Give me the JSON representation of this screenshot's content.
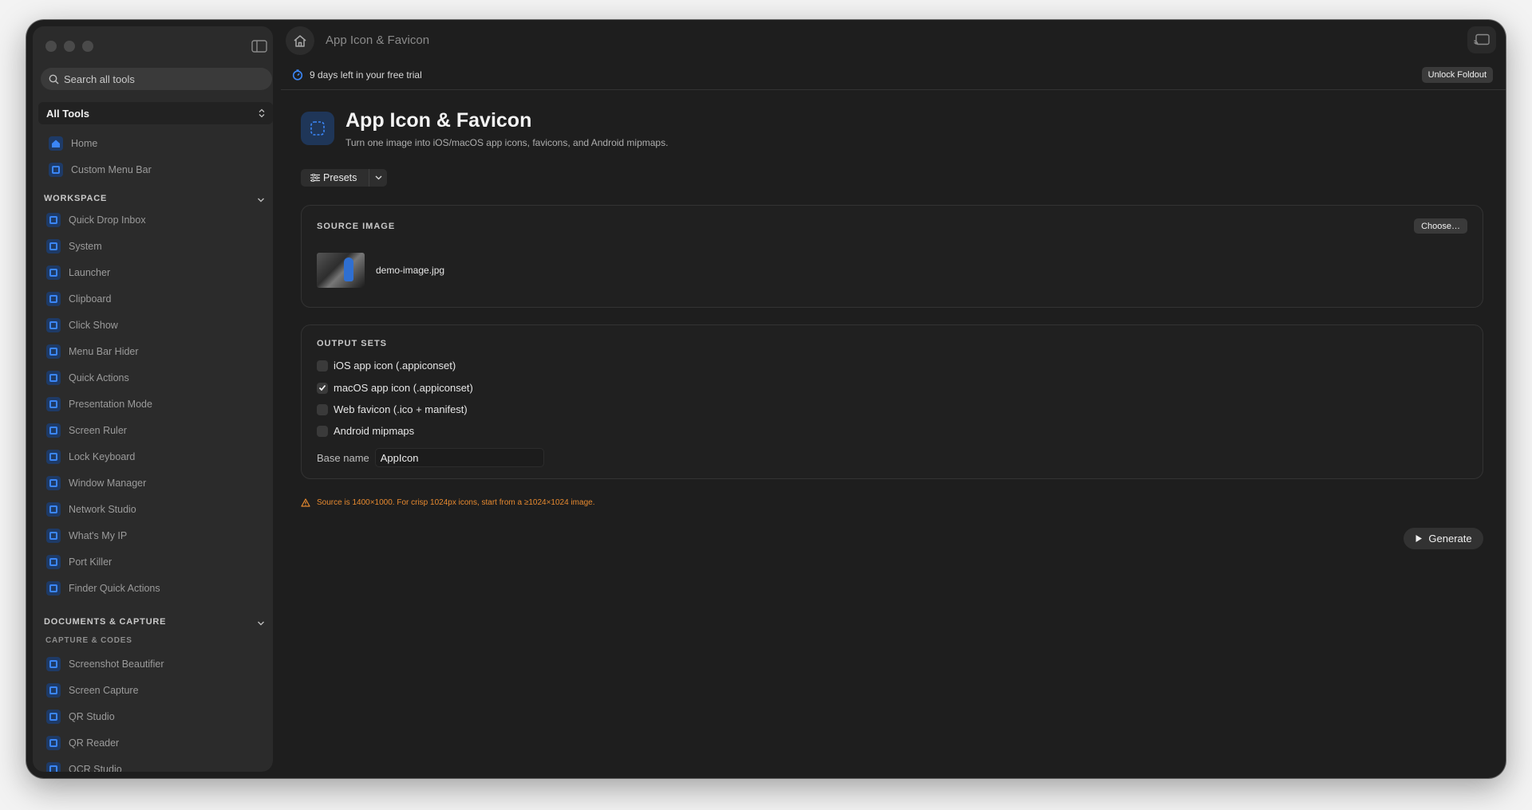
{
  "window": {
    "title": "App Icon & Favicon"
  },
  "sidebar": {
    "search_placeholder": "Search all tools",
    "selector": "All Tools",
    "top_items": [
      {
        "label": "Home",
        "icon": "home-icon"
      },
      {
        "label": "Custom Menu Bar",
        "icon": "menubar-icon"
      }
    ],
    "sections": [
      {
        "title": "WORKSPACE",
        "items": [
          {
            "label": "Quick Drop Inbox"
          },
          {
            "label": "System"
          },
          {
            "label": "Launcher"
          },
          {
            "label": "Clipboard"
          },
          {
            "label": "Click Show"
          },
          {
            "label": "Menu Bar Hider"
          },
          {
            "label": "Quick Actions"
          },
          {
            "label": "Presentation Mode"
          },
          {
            "label": "Screen Ruler"
          },
          {
            "label": "Lock Keyboard"
          },
          {
            "label": "Window Manager"
          },
          {
            "label": "Network Studio"
          },
          {
            "label": "What's My IP"
          },
          {
            "label": "Port Killer"
          },
          {
            "label": "Finder Quick Actions"
          }
        ]
      },
      {
        "title": "DOCUMENTS & CAPTURE",
        "subsection": "CAPTURE & CODES",
        "items": [
          {
            "label": "Screenshot Beautifier"
          },
          {
            "label": "Screen Capture"
          },
          {
            "label": "QR Studio"
          },
          {
            "label": "QR Reader"
          },
          {
            "label": "OCR Studio"
          }
        ]
      }
    ]
  },
  "trial": {
    "text": "9 days left in your free trial",
    "unlock_label": "Unlock Foldout"
  },
  "tool": {
    "title": "App Icon & Favicon",
    "subtitle": "Turn one image into iOS/macOS app icons, favicons, and Android mipmaps.",
    "presets_label": "Presets"
  },
  "source": {
    "label": "SOURCE IMAGE",
    "choose_label": "Choose…",
    "filename": "demo-image.jpg"
  },
  "output": {
    "label": "OUTPUT SETS",
    "options": [
      {
        "label": "iOS app icon (.appiconset)",
        "checked": false
      },
      {
        "label": "macOS app icon (.appiconset)",
        "checked": true
      },
      {
        "label": "Web favicon (.ico + manifest)",
        "checked": false
      },
      {
        "label": "Android mipmaps",
        "checked": false
      }
    ],
    "base_name_label": "Base name",
    "base_name_value": "AppIcon"
  },
  "warning": "Source is 1400×1000. For crisp 1024px icons, start from a ≥1024×1024 image.",
  "generate_label": "Generate",
  "colors": {
    "accent": "#3b86f7",
    "warning": "#e6892f",
    "background": "#1e1e1e",
    "sidebar": "#2b2b2b"
  }
}
